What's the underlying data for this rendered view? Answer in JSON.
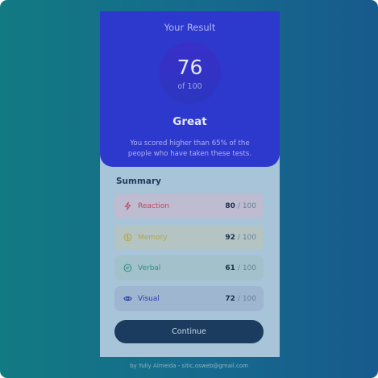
{
  "result": {
    "title": "Your Result",
    "score": "76",
    "score_max_label": "of 100",
    "score_value": 76,
    "rating": "Great",
    "description": "You scored higher than 65% of the people who have taken these tests."
  },
  "summary": {
    "title": "Summary",
    "items": [
      {
        "label": "Reaction",
        "value": "80",
        "max": "/ 100",
        "icon": "lightning-icon",
        "color": "#c6455f"
      },
      {
        "label": "Memory",
        "value": "92",
        "max": "/ 100",
        "icon": "brain-icon",
        "color": "#b7a447"
      },
      {
        "label": "Verbal",
        "value": "61",
        "max": "/ 100",
        "icon": "chat-bubble-icon",
        "color": "#2b8f84"
      },
      {
        "label": "Visual",
        "value": "72",
        "max": "/ 100",
        "icon": "eye-icon",
        "color": "#2d3ea8"
      }
    ]
  },
  "actions": {
    "continue_label": "Continue"
  },
  "footer": {
    "text": "by Yully Almeida - sitic.osweb@gmail.com"
  },
  "colors": {
    "result_bg": "#2d38cd",
    "button_bg": "#1b3c5f",
    "card_bg": "#a7c4d8"
  }
}
